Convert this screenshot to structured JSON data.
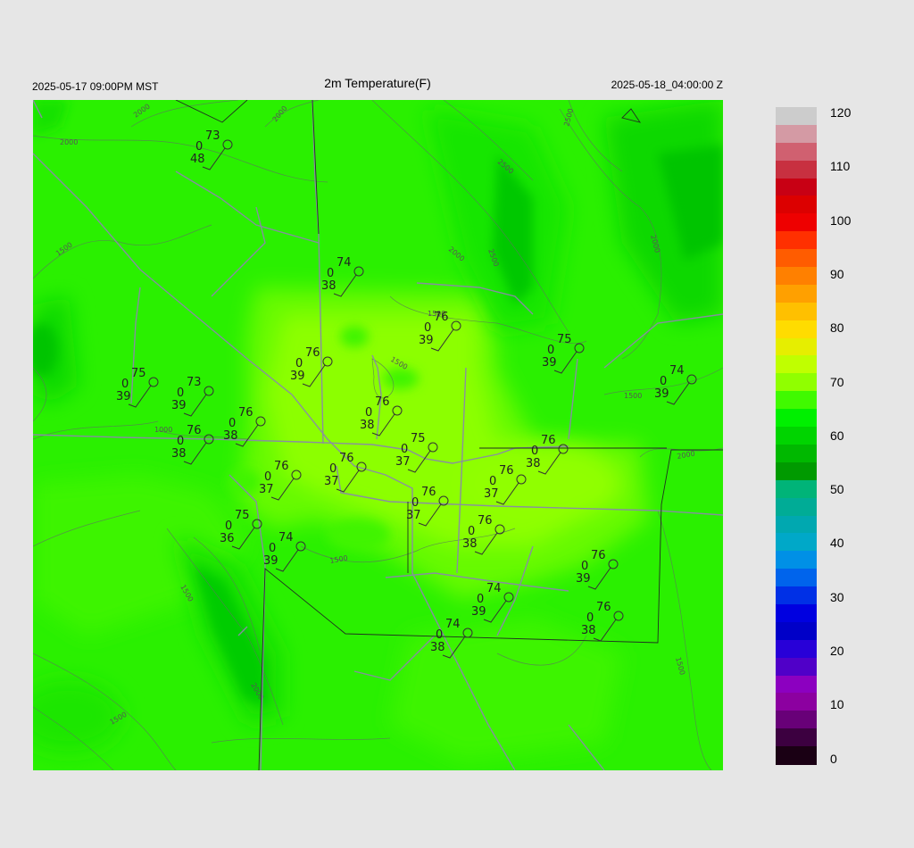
{
  "header": {
    "valid_local": "2025-05-17 09:00PM MST",
    "title": "2m Temperature(F)",
    "valid_utc": "2025-05-18_04:00:00 Z"
  },
  "colorbar": {
    "min": 0,
    "max": 120,
    "tick_labels": [
      "120",
      "110",
      "100",
      "90",
      "80",
      "70",
      "60",
      "50",
      "40",
      "30",
      "20",
      "10",
      "0"
    ],
    "colors": [
      "#1a0014",
      "#3c0040",
      "#680078",
      "#8c00a0",
      "#8c00c0",
      "#5000c8",
      "#2800d8",
      "#0000c8",
      "#0000e0",
      "#0030e6",
      "#0064ec",
      "#0090e6",
      "#00a8c8",
      "#00a8b0",
      "#00ac96",
      "#00b478",
      "#009a00",
      "#00b800",
      "#00d400",
      "#00f000",
      "#40fa00",
      "#90ff00",
      "#c0ff00",
      "#e6ee00",
      "#ffdc00",
      "#ffc000",
      "#ffa000",
      "#ff8000",
      "#ff5c00",
      "#ff3000",
      "#ee0000",
      "#dc0000",
      "#c80014",
      "#c83040",
      "#d06070",
      "#d49aa4",
      "#cccccc"
    ]
  },
  "map": {
    "contour_labels": [
      "2000",
      "2000",
      "2000",
      "2500",
      "2500",
      "2000",
      "2500",
      "2000",
      "1500",
      "1500",
      "1500",
      "1500",
      "1000",
      "2000",
      "1500",
      "1500",
      "2000",
      "1500",
      "1500"
    ],
    "stations": [
      {
        "id": "s1",
        "temp": "73",
        "cloud": "0",
        "dew": "48"
      },
      {
        "id": "s2",
        "temp": "74",
        "cloud": "0",
        "dew": "38"
      },
      {
        "id": "s3",
        "temp": "76",
        "cloud": "0",
        "dew": "39"
      },
      {
        "id": "s4",
        "temp": "75",
        "cloud": "0",
        "dew": "39"
      },
      {
        "id": "s5",
        "temp": "76",
        "cloud": "0",
        "dew": "39"
      },
      {
        "id": "s6",
        "temp": "75",
        "cloud": "0",
        "dew": "39"
      },
      {
        "id": "s7",
        "temp": "73",
        "cloud": "0",
        "dew": "39"
      },
      {
        "id": "s8",
        "temp": "74",
        "cloud": "0",
        "dew": "39"
      },
      {
        "id": "s9",
        "temp": "76",
        "cloud": "0",
        "dew": "38"
      },
      {
        "id": "s10",
        "temp": "76",
        "cloud": "0",
        "dew": "38"
      },
      {
        "id": "s11",
        "temp": "76",
        "cloud": "0",
        "dew": "38"
      },
      {
        "id": "s12",
        "temp": "75",
        "cloud": "0",
        "dew": "37"
      },
      {
        "id": "s13",
        "temp": "76",
        "cloud": "0",
        "dew": "38"
      },
      {
        "id": "s14",
        "temp": "76",
        "cloud": "0",
        "dew": "37"
      },
      {
        "id": "s15",
        "temp": "76",
        "cloud": "0",
        "dew": "37"
      },
      {
        "id": "s16",
        "temp": "76",
        "cloud": "0",
        "dew": "37"
      },
      {
        "id": "s17",
        "temp": "74",
        "cloud": "0",
        "dew": "39"
      },
      {
        "id": "s18",
        "temp": "76",
        "cloud": "0",
        "dew": "37"
      },
      {
        "id": "s19",
        "temp": "75",
        "cloud": "0",
        "dew": "36"
      },
      {
        "id": "s20",
        "temp": "76",
        "cloud": "0",
        "dew": "38"
      },
      {
        "id": "s21",
        "temp": "76",
        "cloud": "0",
        "dew": "39"
      },
      {
        "id": "s22",
        "temp": "74",
        "cloud": "0",
        "dew": "38"
      },
      {
        "id": "s23",
        "temp": "76",
        "cloud": "0",
        "dew": "38"
      },
      {
        "id": "s24",
        "temp": "74",
        "cloud": "0",
        "dew": "39"
      }
    ]
  }
}
